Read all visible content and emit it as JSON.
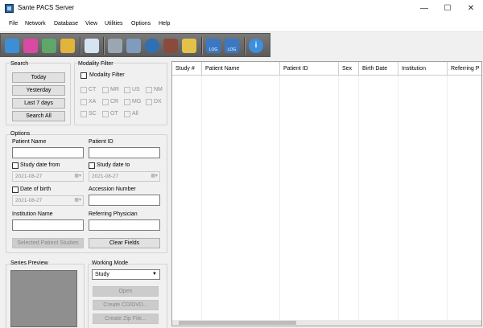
{
  "window": {
    "title": "Sante PACS Server",
    "minimize": "—",
    "maximize": "☐",
    "close": "✕"
  },
  "menu": [
    "File",
    "Network",
    "Database",
    "View",
    "Utilities",
    "Options",
    "Help"
  ],
  "toolbar": {
    "icons": [
      "add-patient-icon",
      "add-study-icon",
      "import-icon",
      "export-icon",
      "document-icon",
      "network-settings-icon",
      "send-icon",
      "transfer-icon",
      "worklist-icon",
      "folder-icon",
      "log-icon",
      "log-list-icon",
      "info-icon"
    ],
    "log1": "LOG",
    "log2": "LOG",
    "info": "i"
  },
  "search": {
    "title": "Search",
    "buttons": [
      "Today",
      "Yesterday",
      "Last 7 days",
      "Search All"
    ]
  },
  "modality": {
    "title": "Modality Filter",
    "checkbox_label": "Modality Filter",
    "items": [
      "CT",
      "MR",
      "US",
      "NM",
      "XA",
      "CR",
      "MG",
      "DX",
      "SC",
      "OT",
      "All"
    ]
  },
  "options": {
    "title": "Options",
    "patient_name_label": "Patient Name",
    "patient_id_label": "Patient ID",
    "study_date_from_label": "Study date from",
    "study_date_to_label": "Study date to",
    "study_date_from_value": "2021-08-27",
    "study_date_to_value": "2021-08-27",
    "dob_label": "Date of birth",
    "dob_value": "2021-08-27",
    "accession_label": "Accession Number",
    "institution_label": "Institution Name",
    "referring_label": "Referring Physician",
    "selected_patient_button": "Selected Patient Studies",
    "clear_button": "Clear Fields"
  },
  "series_preview": {
    "title": "Series Preview"
  },
  "working_mode": {
    "title": "Working Mode",
    "value": "Study",
    "buttons": [
      "Open",
      "Create CD/DVD...",
      "Create Zip File..."
    ]
  },
  "grid": {
    "columns": [
      "Study #",
      "Patient Name",
      "Patient ID",
      "Sex",
      "Birth Date",
      "Institution",
      "Referring P"
    ]
  }
}
